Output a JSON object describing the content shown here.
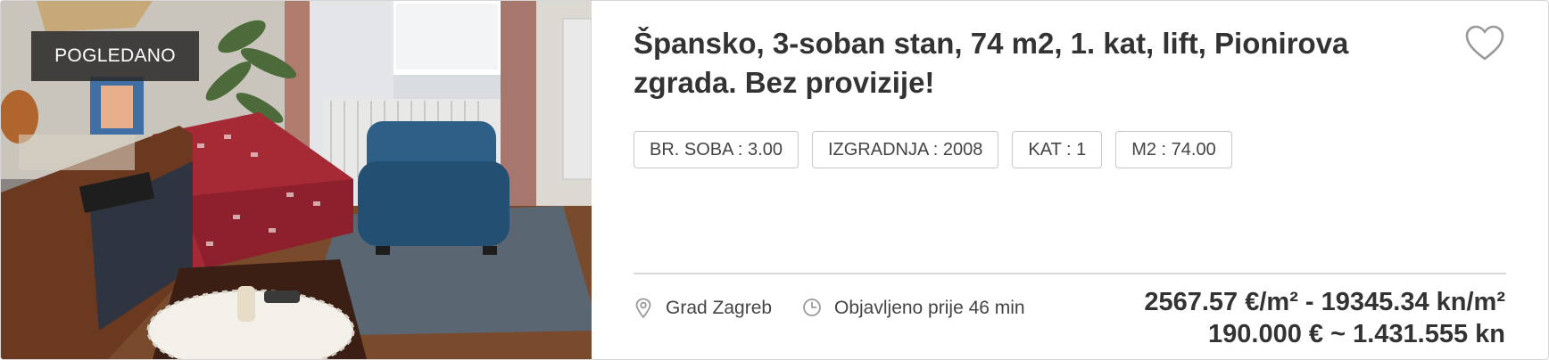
{
  "listing": {
    "badge": "POGLEDANO",
    "title": "Špansko, 3-soban stan, 74 m2, 1. kat, lift, Pionirova zgrada. Bez provizije!",
    "tags": [
      {
        "label": "BR. SOBA : 3.00"
      },
      {
        "label": "IZGRADNJA : 2008"
      },
      {
        "label": "KAT : 1"
      },
      {
        "label": "M2 : 74.00"
      }
    ],
    "location": "Grad Zagreb",
    "published": "Objavljeno prije 46 min",
    "price_per_m2": "2567.57 €/m² - 19345.34 kn/m²",
    "price_total": "190.000 € ~ 1.431.555 kn",
    "icons": {
      "favorite": "heart-outline-icon",
      "location": "location-pin-icon",
      "time": "clock-icon"
    },
    "colors": {
      "title": "#333333",
      "tag_border": "#c8c8c8",
      "badge_bg": "#2c2c2c",
      "icon": "#9a9a9a"
    }
  }
}
